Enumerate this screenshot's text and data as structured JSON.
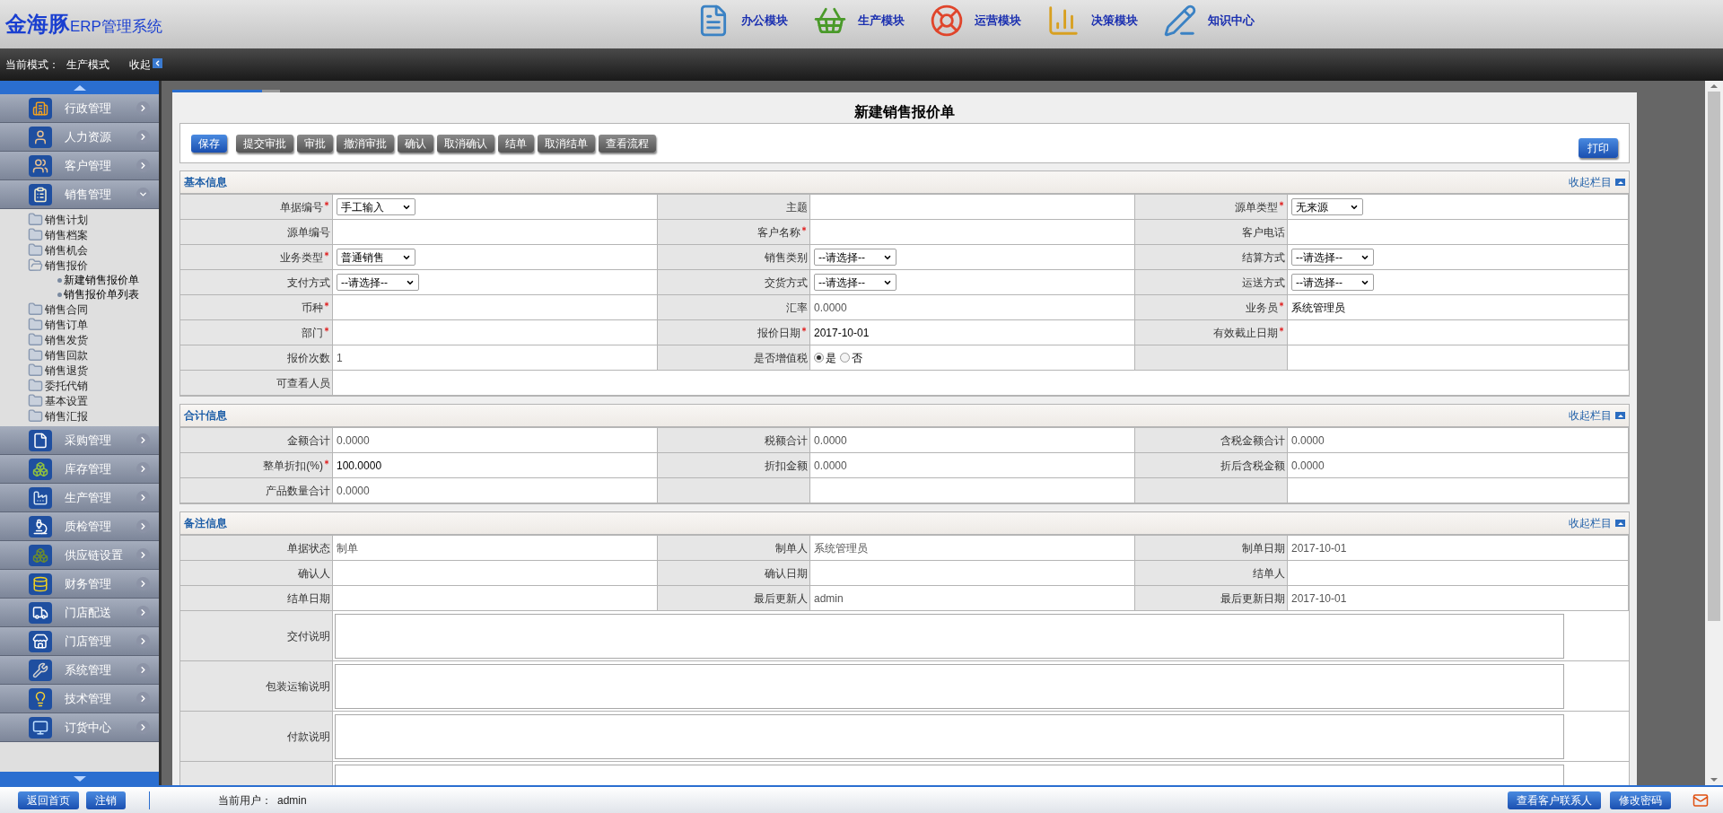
{
  "header": {
    "brand": "金海豚",
    "brand_suffix": "ERP管理系统",
    "modules": [
      {
        "label": "办公模块",
        "kind": "office"
      },
      {
        "label": "生产模块",
        "kind": "production"
      },
      {
        "label": "运营模块",
        "kind": "operation"
      },
      {
        "label": "决策模块",
        "kind": "decision"
      },
      {
        "label": "知识中心",
        "kind": "knowledge"
      }
    ]
  },
  "mode_bar": {
    "label": "当前模式：",
    "value": "生产模式",
    "collapse": "收起"
  },
  "sidebar": {
    "items": [
      {
        "label": "行政管理",
        "kind": "admin",
        "expanded": false
      },
      {
        "label": "人力资源",
        "kind": "hr",
        "expanded": false
      },
      {
        "label": "客户管理",
        "kind": "customer",
        "expanded": false
      },
      {
        "label": "销售管理",
        "kind": "sales",
        "expanded": true,
        "children": [
          {
            "label": "销售计划",
            "expanded": false
          },
          {
            "label": "销售档案",
            "expanded": false
          },
          {
            "label": "销售机会",
            "expanded": false
          },
          {
            "label": "销售报价",
            "expanded": true,
            "children": [
              {
                "label": "新建销售报价单"
              },
              {
                "label": "销售报价单列表"
              }
            ]
          },
          {
            "label": "销售合同",
            "expanded": false
          },
          {
            "label": "销售订单",
            "expanded": false
          },
          {
            "label": "销售发货",
            "expanded": false
          },
          {
            "label": "销售回款",
            "expanded": false
          },
          {
            "label": "销售退货",
            "expanded": false
          },
          {
            "label": "委托代销",
            "expanded": false
          },
          {
            "label": "基本设置",
            "expanded": false
          },
          {
            "label": "销售汇报",
            "expanded": false
          }
        ]
      },
      {
        "label": "采购管理",
        "kind": "purchase",
        "expanded": false
      },
      {
        "label": "库存管理",
        "kind": "stock",
        "expanded": false
      },
      {
        "label": "生产管理",
        "kind": "production",
        "expanded": false
      },
      {
        "label": "质检管理",
        "kind": "quality",
        "expanded": false
      },
      {
        "label": "供应链设置",
        "kind": "supply",
        "expanded": false
      },
      {
        "label": "财务管理",
        "kind": "finance",
        "expanded": false
      },
      {
        "label": "门店配送",
        "kind": "delivery",
        "expanded": false
      },
      {
        "label": "门店管理",
        "kind": "store",
        "expanded": false
      },
      {
        "label": "系统管理",
        "kind": "system",
        "expanded": false
      },
      {
        "label": "技术管理",
        "kind": "tech",
        "expanded": false
      },
      {
        "label": "订货中心",
        "kind": "order",
        "expanded": false
      }
    ]
  },
  "form": {
    "title": "新建销售报价单",
    "toolbar": [
      {
        "label": "保存",
        "kind": "primary"
      },
      {
        "label": "提交审批",
        "kind": "default"
      },
      {
        "label": "审批",
        "kind": "default"
      },
      {
        "label": "撤消审批",
        "kind": "default"
      },
      {
        "label": "确认",
        "kind": "default"
      },
      {
        "label": "取消确认",
        "kind": "default"
      },
      {
        "label": "结单",
        "kind": "default"
      },
      {
        "label": "取消结单",
        "kind": "default"
      },
      {
        "label": "查看流程",
        "kind": "default"
      }
    ],
    "print_button": "打印",
    "sections": [
      {
        "title": "基本信息",
        "collapse": "收起栏目",
        "rows": [
          [
            {
              "label": "单据编号",
              "required": true,
              "kind": "select",
              "value": "手工输入"
            },
            {
              "label": "主题",
              "required": false,
              "kind": "text"
            },
            {
              "label": "源单类型",
              "required": true,
              "kind": "select",
              "value": "无来源"
            }
          ],
          [
            {
              "label": "源单编号",
              "required": false,
              "kind": "text"
            },
            {
              "label": "客户名称",
              "required": true,
              "kind": "text"
            },
            {
              "label": "客户电话",
              "required": false,
              "kind": "text"
            }
          ],
          [
            {
              "label": "业务类型",
              "required": true,
              "kind": "select",
              "value": "普通销售"
            },
            {
              "label": "销售类别",
              "required": false,
              "kind": "select",
              "value": "--请选择--"
            },
            {
              "label": "结算方式",
              "required": false,
              "kind": "select",
              "value": "--请选择--"
            }
          ],
          [
            {
              "label": "支付方式",
              "required": false,
              "kind": "select",
              "value": "--请选择--"
            },
            {
              "label": "交货方式",
              "required": false,
              "kind": "select",
              "value": "--请选择--"
            },
            {
              "label": "运送方式",
              "required": false,
              "kind": "select",
              "value": "--请选择--"
            }
          ],
          [
            {
              "label": "币种",
              "required": true,
              "kind": "text"
            },
            {
              "label": "汇率",
              "required": false,
              "kind": "text",
              "value": "0.0000",
              "muted": true
            },
            {
              "label": "业务员",
              "required": true,
              "kind": "text",
              "value": "系统管理员",
              "muted": false
            }
          ],
          [
            {
              "label": "部门",
              "required": true,
              "kind": "text"
            },
            {
              "label": "报价日期",
              "required": true,
              "kind": "text",
              "value": "2017-10-01",
              "muted": false
            },
            {
              "label": "有效截止日期",
              "required": true,
              "kind": "text"
            }
          ],
          [
            {
              "label": "报价次数",
              "required": false,
              "kind": "text",
              "value": "1",
              "muted": true
            },
            {
              "label": "是否增值税",
              "required": false,
              "kind": "radio",
              "options": [
                {
                  "label": "是",
                  "selected": true
                },
                {
                  "label": "否",
                  "selected": false
                }
              ]
            },
            {
              "required": false,
              "kind": "text"
            }
          ],
          [
            {
              "label": "可查看人员",
              "required": false,
              "kind": "full"
            }
          ]
        ]
      },
      {
        "title": "合计信息",
        "collapse": "收起栏目",
        "rows": [
          [
            {
              "label": "金额合计",
              "required": false,
              "kind": "text",
              "value": "0.0000",
              "muted": true
            },
            {
              "label": "税额合计",
              "required": false,
              "kind": "text",
              "value": "0.0000",
              "muted": true
            },
            {
              "label": "含税金额合计",
              "required": false,
              "kind": "text",
              "value": "0.0000",
              "muted": true
            }
          ],
          [
            {
              "label": "整单折扣(%)",
              "required": true,
              "kind": "text",
              "value": "100.0000",
              "muted": false
            },
            {
              "label": "折扣金额",
              "required": false,
              "kind": "text",
              "value": "0.0000",
              "muted": true
            },
            {
              "label": "折后含税金额",
              "required": false,
              "kind": "text",
              "value": "0.0000",
              "muted": true
            }
          ],
          [
            {
              "label": "产品数量合计",
              "required": false,
              "kind": "text",
              "value": "0.0000",
              "muted": true
            },
            {
              "required": false,
              "kind": "text"
            },
            {
              "required": false,
              "kind": "text"
            }
          ]
        ]
      },
      {
        "title": "备注信息",
        "collapse": "收起栏目",
        "rows": [
          [
            {
              "label": "单据状态",
              "required": false,
              "kind": "text",
              "value": "制单",
              "muted": true
            },
            {
              "label": "制单人",
              "required": false,
              "kind": "text",
              "value": "系统管理员",
              "muted": true
            },
            {
              "label": "制单日期",
              "required": false,
              "kind": "text",
              "value": "2017-10-01",
              "muted": true
            }
          ],
          [
            {
              "label": "确认人",
              "required": false,
              "kind": "text"
            },
            {
              "label": "确认日期",
              "required": false,
              "kind": "text"
            },
            {
              "label": "结单人",
              "required": false,
              "kind": "text"
            }
          ],
          [
            {
              "label": "结单日期",
              "required": false,
              "kind": "text"
            },
            {
              "label": "最后更新人",
              "required": false,
              "kind": "text",
              "value": "admin",
              "muted": true
            },
            {
              "label": "最后更新日期",
              "required": false,
              "kind": "text",
              "value": "2017-10-01",
              "muted": true
            }
          ],
          [
            {
              "label": "交付说明",
              "required": false,
              "kind": "textarea"
            }
          ],
          [
            {
              "label": "包装运输说明",
              "required": false,
              "kind": "textarea"
            }
          ],
          [
            {
              "label": "付款说明",
              "required": false,
              "kind": "textarea"
            }
          ],
          [
            {
              "required": false,
              "kind": "textarea"
            }
          ]
        ]
      }
    ]
  },
  "footer": {
    "buttons": [
      {
        "label": "返回首页"
      },
      {
        "label": "注销"
      }
    ],
    "user_label": "当前用户：",
    "user": "admin",
    "right_buttons": [
      {
        "label": "查看客户联系人"
      },
      {
        "label": "修改密码"
      }
    ]
  }
}
